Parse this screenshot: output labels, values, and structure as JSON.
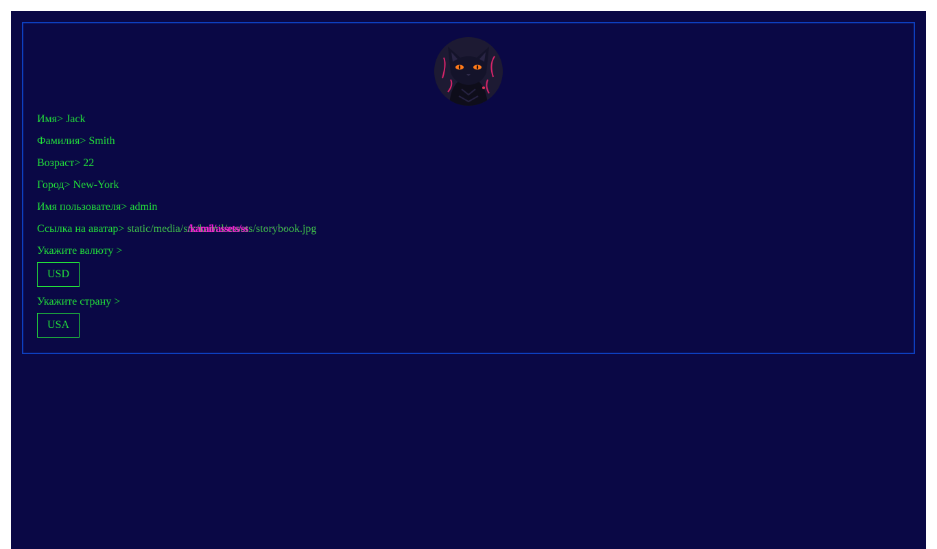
{
  "profile": {
    "first_name_label": "Имя> ",
    "first_name": "Jack",
    "last_name_label": "Фамилия> ",
    "last_name": "Smith",
    "age_label": "Возраст> ",
    "age": "22",
    "city_label": "Город> ",
    "city": "New-York",
    "username_label": "Имя пользователя> ",
    "username": "admin",
    "avatar_link_label": "Ссылка на аватар> ",
    "avatar_link": "static/media/src/kamil/assets/storybook.jpg"
  },
  "currency": {
    "label": "Укажите валюту >",
    "selected": "USD"
  },
  "country": {
    "label": "Укажите страну >",
    "selected": "USA"
  },
  "avatar": {
    "icon": "black-cat-avatar"
  },
  "colors": {
    "background": "#0a0845",
    "border": "#0d3fbf",
    "text": "#22e03a",
    "glitch": "#ff1dd8"
  }
}
